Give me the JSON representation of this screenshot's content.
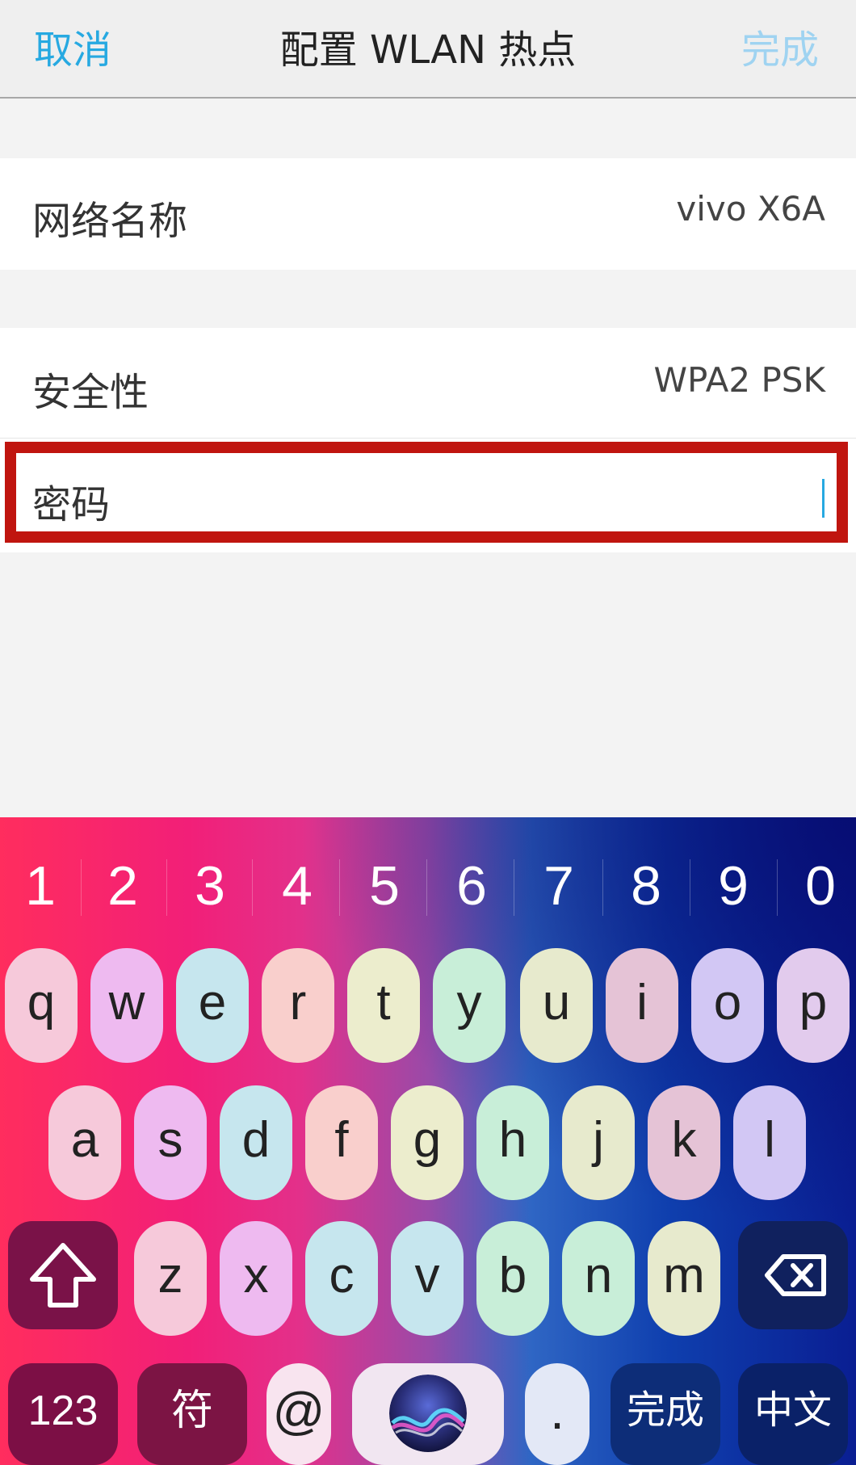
{
  "navbar": {
    "cancel_label": "取消",
    "title": "配置 WLAN 热点",
    "done_label": "完成"
  },
  "settings": {
    "network_name_label": "网络名称",
    "network_name_value": "vivo X6A",
    "security_label": "安全性",
    "security_value": "WPA2 PSK",
    "password_label": "密码",
    "password_value": ""
  },
  "keyboard": {
    "numbers": [
      "1",
      "2",
      "3",
      "4",
      "5",
      "6",
      "7",
      "8",
      "9",
      "0"
    ],
    "row1": [
      "q",
      "w",
      "e",
      "r",
      "t",
      "y",
      "u",
      "i",
      "o",
      "p"
    ],
    "row2": [
      "a",
      "s",
      "d",
      "f",
      "g",
      "h",
      "j",
      "k",
      "l"
    ],
    "row3": [
      "z",
      "x",
      "c",
      "v",
      "b",
      "n",
      "m"
    ],
    "key_123": "123",
    "key_symbols": "符",
    "key_at": "@",
    "key_dot": ".",
    "key_done": "完成",
    "key_chinese": "中文"
  },
  "colors": {
    "accent": "#27a9e1",
    "done_disabled": "#9fd3f1",
    "highlight": "#c0150f"
  }
}
